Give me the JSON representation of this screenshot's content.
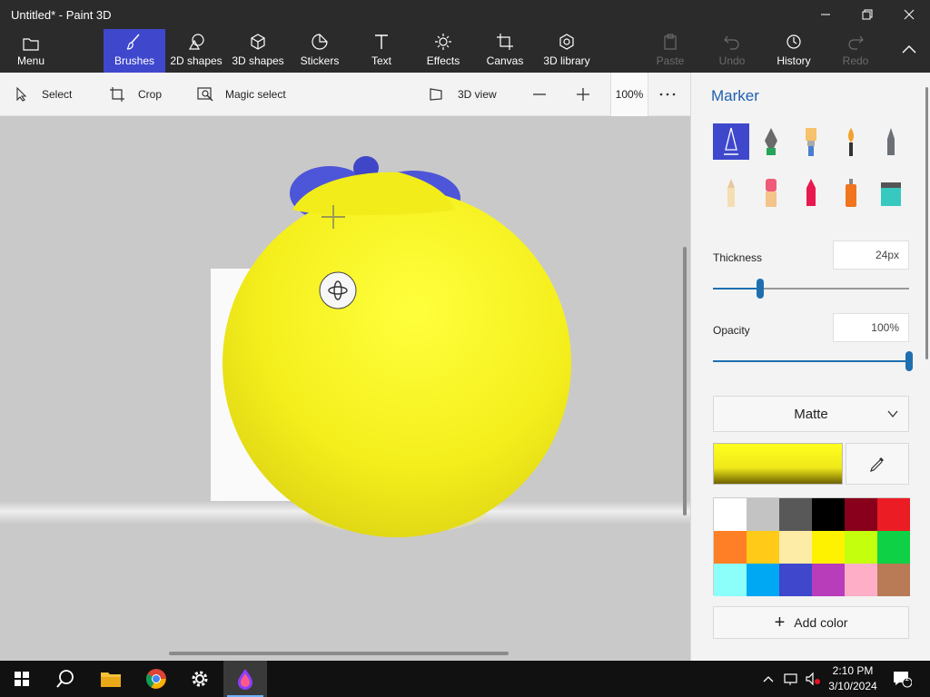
{
  "window": {
    "title": "Untitled* - Paint 3D"
  },
  "ribbon": {
    "items": [
      {
        "label": "Menu",
        "icon": "folder-icon"
      },
      {
        "label": "Brushes",
        "icon": "brush-icon",
        "active": true
      },
      {
        "label": "2D shapes",
        "icon": "2d-shapes-icon"
      },
      {
        "label": "3D shapes",
        "icon": "3d-cube-icon"
      },
      {
        "label": "Stickers",
        "icon": "sticker-icon"
      },
      {
        "label": "Text",
        "icon": "text-icon"
      },
      {
        "label": "Effects",
        "icon": "sun-effects-icon"
      },
      {
        "label": "Canvas",
        "icon": "canvas-crop-icon"
      },
      {
        "label": "3D library",
        "icon": "3d-library-icon"
      },
      {
        "label": "Paste",
        "icon": "paste-icon",
        "disabled": true
      },
      {
        "label": "Undo",
        "icon": "undo-icon",
        "disabled": true
      },
      {
        "label": "History",
        "icon": "history-icon"
      },
      {
        "label": "Redo",
        "icon": "redo-icon",
        "disabled": true
      }
    ]
  },
  "toolbar": {
    "select": "Select",
    "crop": "Crop",
    "magic_select": "Magic select",
    "view_3d": "3D view",
    "zoom": "100%"
  },
  "panel": {
    "title": "Marker",
    "thickness_label": "Thickness",
    "thickness_value": "24px",
    "thickness_fraction": 0.24,
    "opacity_label": "Opacity",
    "opacity_value": "100%",
    "opacity_fraction": 1.0,
    "material": "Matte",
    "current_color": "#fcf51c",
    "add_color": "Add color",
    "brushes": [
      "marker",
      "calligraphy-pen",
      "oil-brush",
      "watercolor",
      "pixel-pen",
      "pencil",
      "eraser",
      "crayon",
      "spray-can",
      "fill-bucket"
    ],
    "palette": [
      "#ffffff",
      "#c3c3c3",
      "#585858",
      "#000000",
      "#88001b",
      "#ec1c24",
      "#ff7f27",
      "#ffca18",
      "#fdeca6",
      "#fff200",
      "#c4ff0e",
      "#0ed145",
      "#8cfffb",
      "#00a8f3",
      "#3f48cc",
      "#b83dba",
      "#ffaec8",
      "#b97a56"
    ]
  },
  "taskbar": {
    "time": "2:10 PM",
    "date": "3/10/2024",
    "notifications": "1"
  }
}
